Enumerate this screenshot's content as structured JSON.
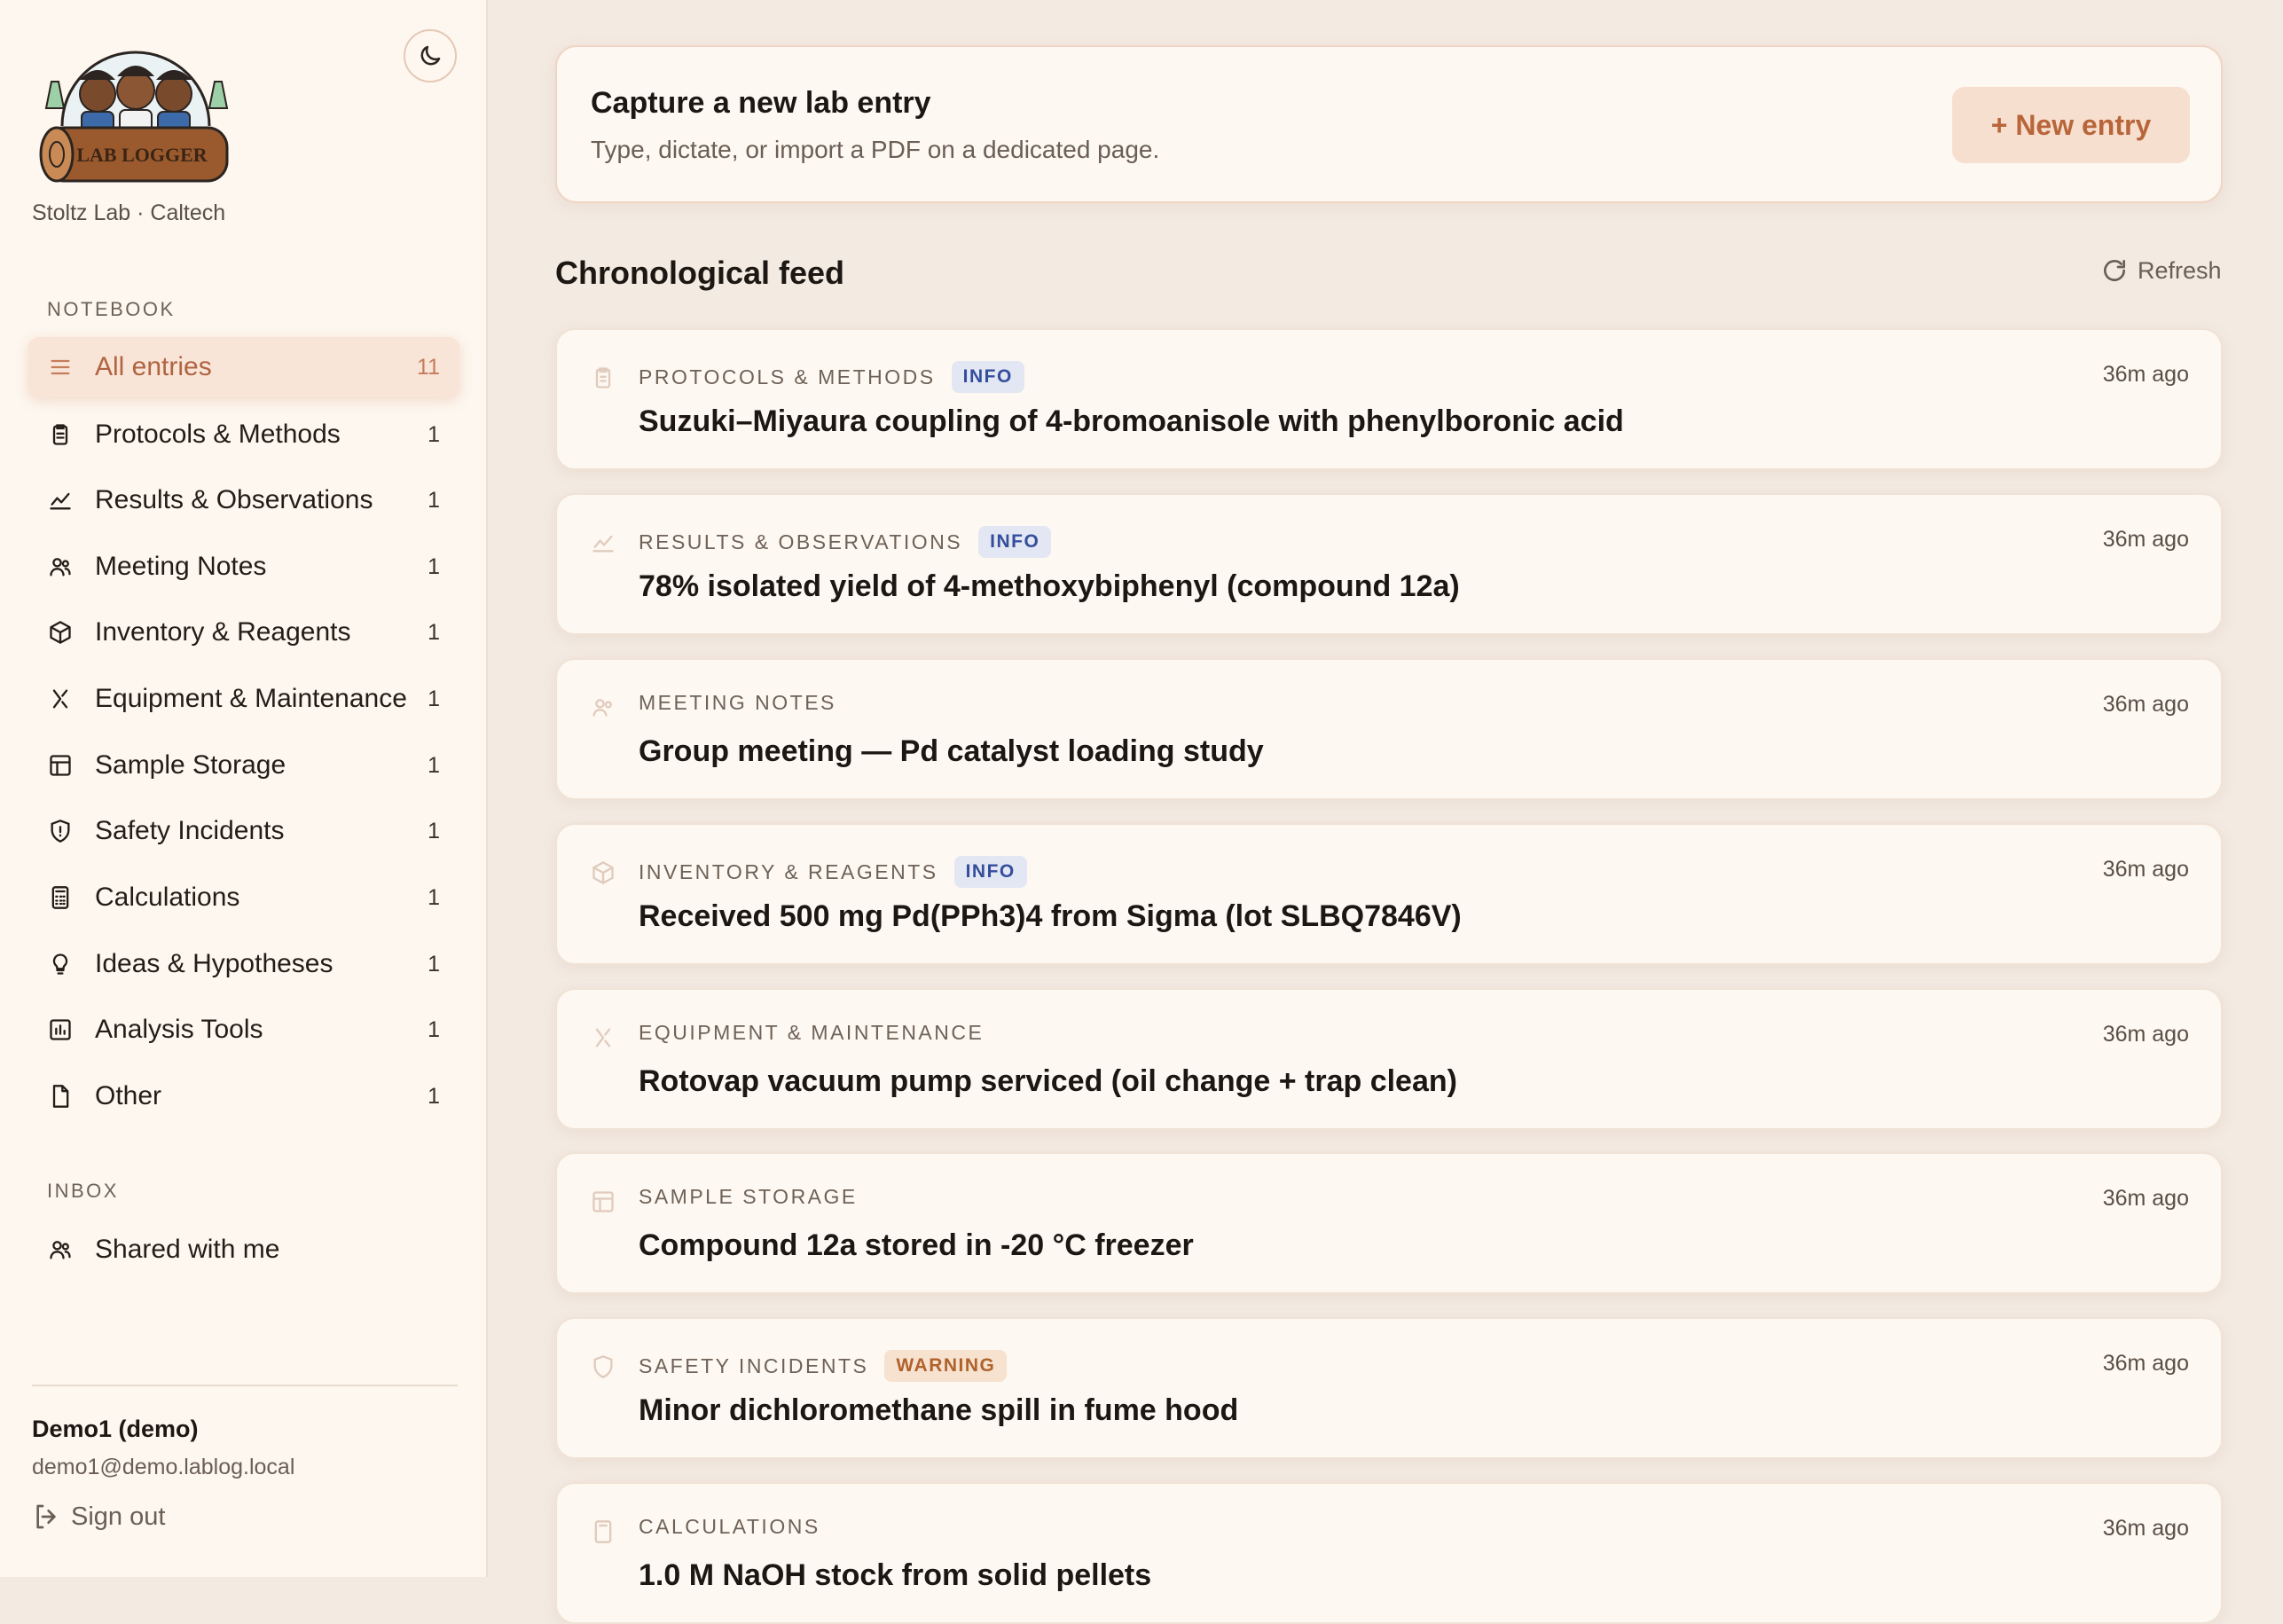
{
  "app": {
    "logo_text": "LAB LOGGER",
    "lab_name": "Stoltz Lab · Caltech"
  },
  "sidebar": {
    "notebook_label": "NOTEBOOK",
    "items": [
      {
        "label": "All entries",
        "count": "11",
        "icon": "list-icon"
      },
      {
        "label": "Protocols & Methods",
        "count": "1",
        "icon": "clipboard-icon"
      },
      {
        "label": "Results & Observations",
        "count": "1",
        "icon": "trend-chart-icon"
      },
      {
        "label": "Meeting Notes",
        "count": "1",
        "icon": "users-icon"
      },
      {
        "label": "Inventory & Reagents",
        "count": "1",
        "icon": "box-icon"
      },
      {
        "label": "Equipment & Maintenance",
        "count": "1",
        "icon": "wrench-icon"
      },
      {
        "label": "Sample Storage",
        "count": "1",
        "icon": "grid-icon"
      },
      {
        "label": "Safety Incidents",
        "count": "1",
        "icon": "shield-alert-icon"
      },
      {
        "label": "Calculations",
        "count": "1",
        "icon": "calculator-icon"
      },
      {
        "label": "Ideas & Hypotheses",
        "count": "1",
        "icon": "lightbulb-icon"
      },
      {
        "label": "Analysis Tools",
        "count": "1",
        "icon": "bar-chart-icon"
      },
      {
        "label": "Other",
        "count": "1",
        "icon": "file-icon"
      }
    ],
    "inbox_label": "INBOX",
    "inbox_items": [
      {
        "label": "Shared with me",
        "icon": "users-icon"
      }
    ]
  },
  "user": {
    "name": "Demo1 (demo)",
    "email": "demo1@demo.lablog.local",
    "signout_label": "Sign out"
  },
  "capture": {
    "title": "Capture a new lab entry",
    "subtitle": "Type, dictate, or import a PDF on a dedicated page.",
    "button_label": "+ New entry"
  },
  "feed": {
    "title": "Chronological feed",
    "refresh_label": "Refresh",
    "entries": [
      {
        "category": "PROTOCOLS & METHODS",
        "badge": "INFO",
        "title": "Suzuki–Miyaura coupling of 4-bromoanisole with phenylboronic acid",
        "time": "36m ago"
      },
      {
        "category": "RESULTS & OBSERVATIONS",
        "badge": "INFO",
        "title": "78% isolated yield of 4-methoxybiphenyl (compound 12a)",
        "time": "36m ago"
      },
      {
        "category": "MEETING NOTES",
        "badge": "",
        "title": "Group meeting — Pd catalyst loading study",
        "time": "36m ago"
      },
      {
        "category": "INVENTORY & REAGENTS",
        "badge": "INFO",
        "title": "Received 500 mg Pd(PPh3)4 from Sigma (lot SLBQ7846V)",
        "time": "36m ago"
      },
      {
        "category": "EQUIPMENT & MAINTENANCE",
        "badge": "",
        "title": "Rotovap vacuum pump serviced (oil change + trap clean)",
        "time": "36m ago"
      },
      {
        "category": "SAMPLE STORAGE",
        "badge": "",
        "title": "Compound 12a stored in -20 °C freezer",
        "time": "36m ago"
      },
      {
        "category": "SAFETY INCIDENTS",
        "badge": "WARNING",
        "title": "Minor dichloromethane spill in fume hood",
        "time": "36m ago"
      },
      {
        "category": "CALCULATIONS",
        "badge": "",
        "title": "1.0 M NaOH stock from solid pellets",
        "time": "36m ago"
      }
    ]
  },
  "colors": {
    "accent": "#b8653a",
    "sidebar_bg": "#fdf7ef",
    "main_bg": "#f3eae2",
    "info_badge": "#344e9c",
    "warning_badge": "#b0622c"
  }
}
